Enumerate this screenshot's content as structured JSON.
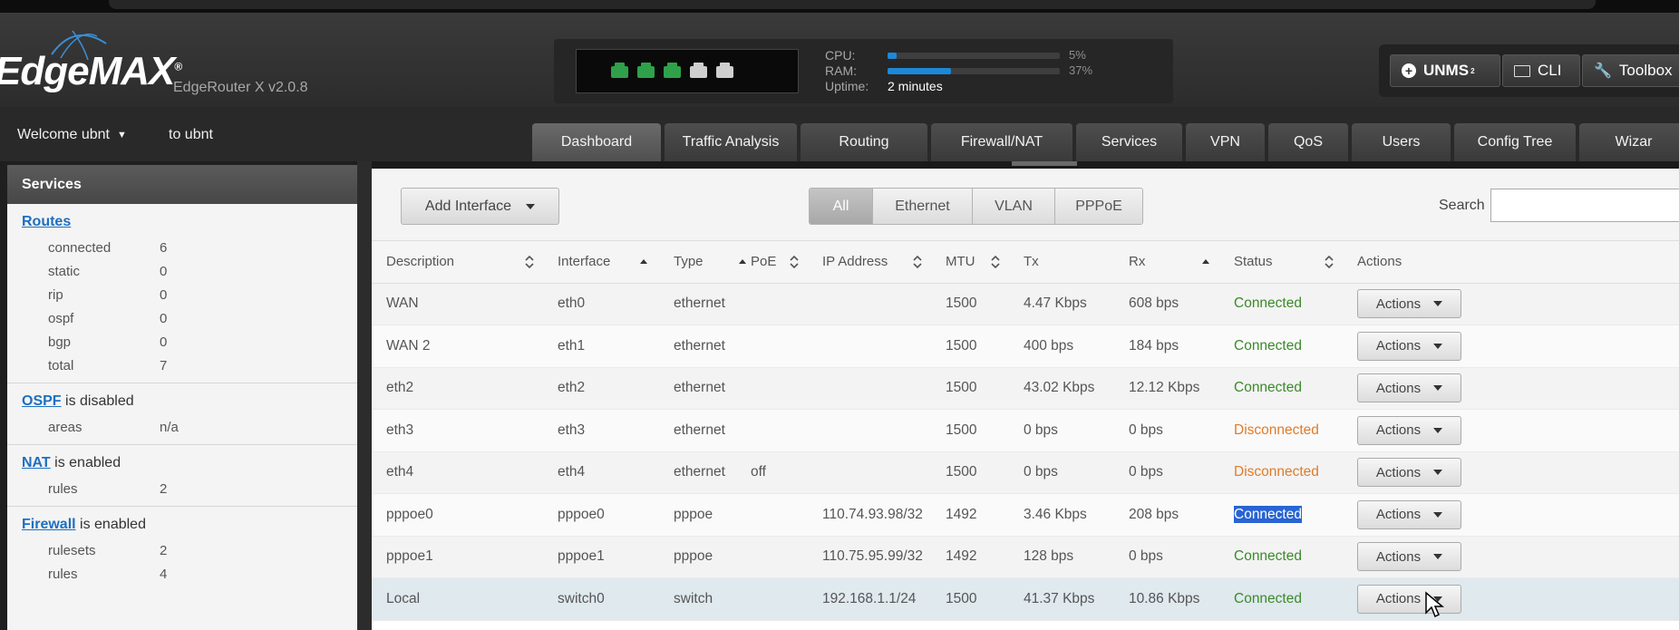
{
  "header": {
    "logo": "EdgeMAX",
    "logo_mark": "®",
    "version": "EdgeRouter X v2.0.8",
    "ports": [
      {
        "name": "eth0",
        "color": "#2fa14a"
      },
      {
        "name": "eth1",
        "color": "#2fa14a"
      },
      {
        "name": "eth2",
        "color": "#2fa14a"
      },
      {
        "name": "eth3",
        "color": "#cfcfcf"
      },
      {
        "name": "eth4",
        "color": "#cfcfcf"
      }
    ],
    "cpu": {
      "label": "CPU:",
      "percent": 5,
      "text": "5%"
    },
    "ram": {
      "label": "RAM:",
      "percent": 37,
      "text": "37%"
    },
    "uptime": {
      "label": "Uptime:",
      "value": "2 minutes"
    },
    "tools": {
      "unms": "UNMS",
      "unms_sup": "2",
      "cli": "CLI",
      "toolbox": "Toolbox"
    }
  },
  "nav": {
    "welcome": "Welcome ubnt",
    "to_user": "to ubnt",
    "tabs": [
      "Dashboard",
      "Traffic Analysis",
      "Routing",
      "Firewall/NAT",
      "Services",
      "VPN",
      "QoS",
      "Users",
      "Config Tree",
      "Wizar"
    ],
    "active_tab": "Dashboard"
  },
  "sidebar": {
    "title": "Services",
    "routes": {
      "title": "Routes",
      "rows": [
        {
          "k": "connected",
          "v": "6"
        },
        {
          "k": "static",
          "v": "0"
        },
        {
          "k": "rip",
          "v": "0"
        },
        {
          "k": "ospf",
          "v": "0"
        },
        {
          "k": "bgp",
          "v": "0"
        },
        {
          "k": "total",
          "v": "7"
        }
      ]
    },
    "ospf": {
      "link": "OSPF",
      "status": " is disabled",
      "rows": [
        {
          "k": "areas",
          "v": "n/a"
        }
      ]
    },
    "nat": {
      "link": "NAT",
      "status": " is enabled",
      "rows": [
        {
          "k": "rules",
          "v": "2"
        }
      ]
    },
    "firewall": {
      "link": "Firewall",
      "status": " is enabled",
      "rows": [
        {
          "k": "rulesets",
          "v": "2"
        },
        {
          "k": "rules",
          "v": "4"
        }
      ]
    }
  },
  "main": {
    "add_interface": "Add Interface",
    "filters": [
      "All",
      "Ethernet",
      "VLAN",
      "PPPoE"
    ],
    "active_filter": "All",
    "search_label": "Search",
    "search_value": "",
    "columns": [
      "Description",
      "Interface",
      "Type",
      "PoE",
      "IP Address",
      "MTU",
      "Tx",
      "Rx",
      "Status",
      "Actions"
    ],
    "rows": [
      {
        "description": "WAN",
        "interface": "eth0",
        "type": "ethernet",
        "poe": "",
        "ip": "",
        "mtu": "1500",
        "tx": "4.47 Kbps",
        "rx": "608 bps",
        "status": "Connected",
        "status_kind": "connected"
      },
      {
        "description": "WAN 2",
        "interface": "eth1",
        "type": "ethernet",
        "poe": "",
        "ip": "",
        "mtu": "1500",
        "tx": "400 bps",
        "rx": "184 bps",
        "status": "Connected",
        "status_kind": "connected"
      },
      {
        "description": "eth2",
        "interface": "eth2",
        "type": "ethernet",
        "poe": "",
        "ip": "",
        "mtu": "1500",
        "tx": "43.02 Kbps",
        "rx": "12.12 Kbps",
        "status": "Connected",
        "status_kind": "connected"
      },
      {
        "description": "eth3",
        "interface": "eth3",
        "type": "ethernet",
        "poe": "",
        "ip": "",
        "mtu": "1500",
        "tx": "0 bps",
        "rx": "0 bps",
        "status": "Disconnected",
        "status_kind": "disconnected"
      },
      {
        "description": "eth4",
        "interface": "eth4",
        "type": "ethernet",
        "poe": "off",
        "ip": "",
        "mtu": "1500",
        "tx": "0 bps",
        "rx": "0 bps",
        "status": "Disconnected",
        "status_kind": "disconnected"
      },
      {
        "description": "pppoe0",
        "interface": "pppoe0",
        "type": "pppoe",
        "poe": "",
        "ip": "110.74.93.98/32",
        "mtu": "1492",
        "tx": "3.46 Kbps",
        "rx": "208 bps",
        "status": "Connected",
        "status_kind": "selected"
      },
      {
        "description": "pppoe1",
        "interface": "pppoe1",
        "type": "pppoe",
        "poe": "",
        "ip": "110.75.95.99/32",
        "mtu": "1492",
        "tx": "128 bps",
        "rx": "0 bps",
        "status": "Connected",
        "status_kind": "connected"
      },
      {
        "description": "Local",
        "interface": "switch0",
        "type": "switch",
        "poe": "",
        "ip": "192.168.1.1/24",
        "mtu": "1500",
        "tx": "41.37 Kbps",
        "rx": "10.86 Kbps",
        "status": "Connected",
        "status_kind": "connected",
        "highlight": true
      }
    ],
    "action_label": "Actions"
  },
  "colors": {
    "connected": "#3b8a2a",
    "disconnected": "#e07b2a",
    "link": "#1e6fc1",
    "accent": "#1e88d8"
  }
}
